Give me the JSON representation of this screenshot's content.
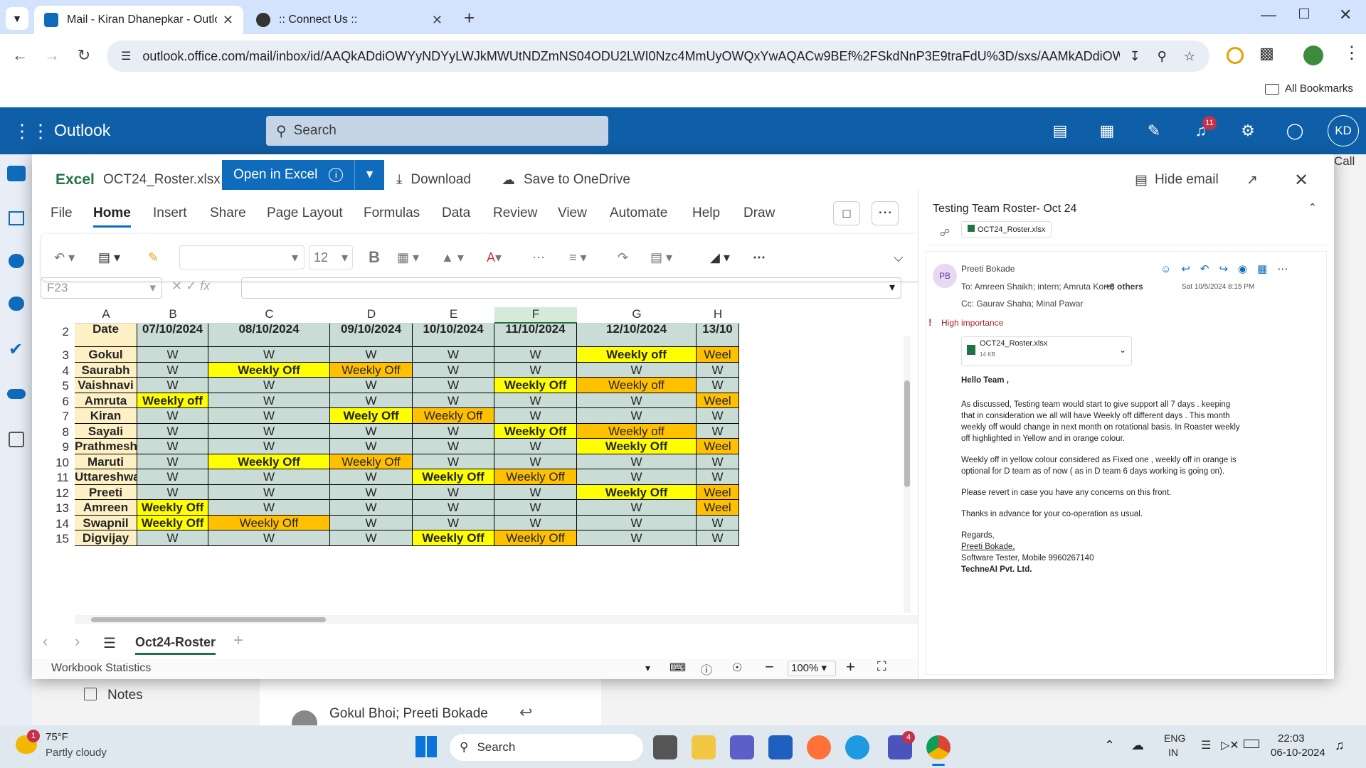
{
  "browser": {
    "tabs": [
      {
        "title": "Mail - Kiran Dhanepkar - Outlook"
      },
      {
        "title": ":: Connect Us ::"
      }
    ],
    "url": "outlook.office.com/mail/inbox/id/AAQkADdiOWYyNDYyLWJkMWUtNDZmNS04ODU2LWI0Nzc4MmUyOWQxYwAQACw9BEf%2FSkdNnP3E9traFdU%3D/sxs/AAMkADdiOWYyND...",
    "bookmarks_label": "All Bookmarks"
  },
  "outlook": {
    "app_name": "Outlook",
    "search_placeholder": "Search",
    "notif_count": "11",
    "avatar": "KD",
    "bg_notes": "Notes",
    "bg_sender": "Gokul Bhoi; Preeti Bokade",
    "bg_call": "Call"
  },
  "excel": {
    "app_label": "Excel",
    "filename": "OCT24_Roster.xlsx",
    "open_btn": "Open in Excel",
    "download": "Download",
    "save_onedrive": "Save to OneDrive",
    "hide_email": "Hide email",
    "menus": [
      "File",
      "Home",
      "Insert",
      "Share",
      "Page Layout",
      "Formulas",
      "Data",
      "Review",
      "View",
      "Automate",
      "Help",
      "Draw"
    ],
    "font_size": "12",
    "name_box": "F23",
    "sheet_tab": "Oct24-Roster",
    "status_left": "Workbook Statistics",
    "zoom": "100%"
  },
  "grid": {
    "columns": [
      "A",
      "B",
      "C",
      "D",
      "E",
      "F",
      "G",
      "H"
    ],
    "row_numbers": [
      "2",
      "3",
      "4",
      "5",
      "6",
      "7",
      "8",
      "9",
      "10",
      "11",
      "12",
      "13",
      "14",
      "15"
    ],
    "header_row": [
      "Date",
      "07/10/2024",
      "08/10/2024",
      "09/10/2024",
      "10/10/2024",
      "11/10/2024",
      "12/10/2024",
      "13/10"
    ],
    "rows": [
      [
        "Gokul",
        "W",
        "W",
        "W",
        "W",
        "W",
        "Weekly off",
        "Weel"
      ],
      [
        "Saurabh",
        "W",
        "Weekly Off",
        "Weekly Off",
        "W",
        "W",
        "W",
        "W"
      ],
      [
        "Vaishnavi",
        "W",
        "W",
        "W",
        "W",
        "Weekly Off",
        "Weekly off",
        "W"
      ],
      [
        "Amruta",
        "Weekly off",
        "W",
        "W",
        "W",
        "W",
        "W",
        "Weel"
      ],
      [
        "Kiran",
        "W",
        "W",
        "Weely Off",
        "Weekly Off",
        "W",
        "W",
        "W"
      ],
      [
        "Sayali",
        "W",
        "W",
        "W",
        "W",
        "Weekly Off",
        "Weekly off",
        "W"
      ],
      [
        "Prathmesh",
        "W",
        "W",
        "W",
        "W",
        "W",
        "Weekly Off",
        "Weel"
      ],
      [
        "Maruti",
        "W",
        "Weekly Off",
        "Weekly Off",
        "W",
        "W",
        "W",
        "W"
      ],
      [
        "Uttareshwar",
        "W",
        "W",
        "W",
        "Weekly Off",
        "Weekly Off",
        "W",
        "W"
      ],
      [
        "Preeti",
        "W",
        "W",
        "W",
        "W",
        "W",
        "Weekly Off",
        "Weel"
      ],
      [
        "Amreen",
        "Weekly Off",
        "W",
        "W",
        "W",
        "W",
        "W",
        "Weel"
      ],
      [
        "Swapnil",
        "Weekly Off",
        "Weekly Off",
        "W",
        "W",
        "W",
        "W",
        "W"
      ],
      [
        "Digvijay",
        "W",
        "W",
        "W",
        "Weekly Off",
        "Weekly Off",
        "W",
        "W"
      ]
    ],
    "fills": [
      [
        "n",
        "g",
        "g",
        "g",
        "g",
        "g",
        "y",
        "o"
      ],
      [
        "n",
        "g",
        "y",
        "o",
        "g",
        "g",
        "g",
        "g"
      ],
      [
        "n",
        "g",
        "g",
        "g",
        "g",
        "y",
        "o",
        "g"
      ],
      [
        "n",
        "y",
        "g",
        "g",
        "g",
        "g",
        "g",
        "o"
      ],
      [
        "n",
        "g",
        "g",
        "y",
        "o",
        "g",
        "g",
        "g"
      ],
      [
        "n",
        "g",
        "g",
        "g",
        "g",
        "y",
        "o",
        "g"
      ],
      [
        "n",
        "g",
        "g",
        "g",
        "g",
        "g",
        "y",
        "o"
      ],
      [
        "n",
        "g",
        "y",
        "o",
        "g",
        "g",
        "g",
        "g"
      ],
      [
        "n",
        "g",
        "g",
        "g",
        "y",
        "o",
        "g",
        "g"
      ],
      [
        "n",
        "g",
        "g",
        "g",
        "g",
        "g",
        "y",
        "o"
      ],
      [
        "n",
        "y",
        "g",
        "g",
        "g",
        "g",
        "g",
        "o"
      ],
      [
        "n",
        "y",
        "o",
        "g",
        "g",
        "g",
        "g",
        "g"
      ],
      [
        "n",
        "g",
        "g",
        "g",
        "y",
        "o",
        "g",
        "g"
      ]
    ],
    "colors": {
      "n": "#fdf0c4",
      "g": "#c9dcd6",
      "y": "#ffff00",
      "o": "#ffc000",
      "hdr": "#c9dcd6"
    }
  },
  "email": {
    "subject": "Testing Team Roster- Oct 24",
    "attachment_chip": "OCT24_Roster.xlsx",
    "sender": "Preeti Bokade",
    "sender_initials": "PB",
    "to": "To:  Amreen Shaikh;   intern;   Amruta Kore;",
    "to_more": "+8 others",
    "date": "Sat 10/5/2024 8:15 PM",
    "cc": "Cc:  Gaurav Shaha;   Minal Pawar",
    "importance": "High importance",
    "attachment_name": "OCT24_Roster.xlsx",
    "attachment_size": "14 KB",
    "greeting": "Hello Team ,",
    "para1": "As discussed, Testing team would start to give support all 7 days . keeping that in consideration we all will have Weekly off different days . This month weekly off would change in next month on rotational basis. In Roaster weekly off highlighted in Yellow and in orange colour.",
    "para2": "Weekly off in yellow colour considered as Fixed one , weekly off in orange is optional for D team as of now ( as in D team 6 days working is going on).",
    "para3": "Please revert in case you have any concerns on this front.",
    "para4": "Thanks in advance for your co-operation as usual.",
    "regards": "Regards,",
    "sig_name": "Preeti Bokade,",
    "sig_title": "Software Tester, Mobile 9960267140",
    "sig_company": "TechneAI Pvt. Ltd."
  },
  "taskbar": {
    "weather_temp": "75°F",
    "weather_desc": "Partly cloudy",
    "weather_badge": "1",
    "search": "Search",
    "teams_badge": "4",
    "lang1": "ENG",
    "lang2": "IN",
    "time": "22:03",
    "date": "06-10-2024"
  }
}
